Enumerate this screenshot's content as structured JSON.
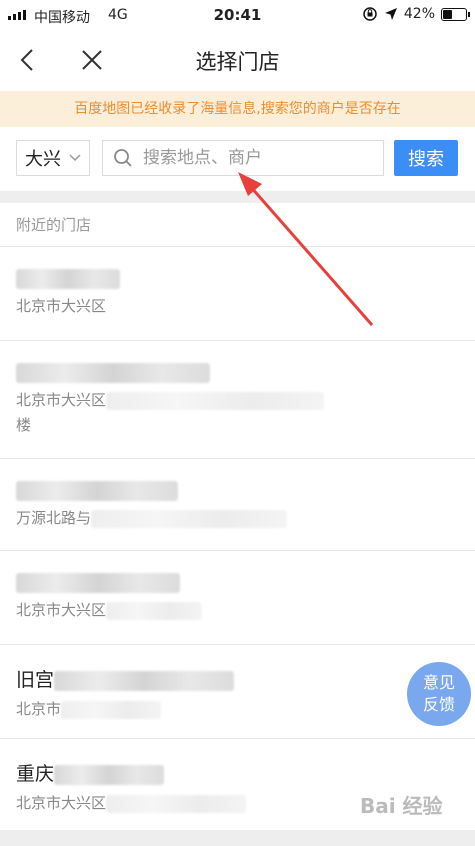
{
  "status_bar": {
    "carrier": "中国移动",
    "network": "4G",
    "time": "20:41",
    "battery": "42%",
    "battery_level": 0.42,
    "icons": [
      "signal-icon",
      "orientation-lock-icon",
      "location-arrow-icon",
      "battery-icon"
    ]
  },
  "nav": {
    "title": "选择门店",
    "back_icon": "chevron-left-icon",
    "close_icon": "close-icon"
  },
  "notice": {
    "text": "百度地图已经收录了海量信息,搜索您的商户是否存在"
  },
  "search": {
    "city": "大兴",
    "placeholder": "搜索地点、商户",
    "value": "",
    "button_label": "搜索"
  },
  "nearby": {
    "section_title": "附近的门店",
    "items": [
      {
        "name_prefix": "",
        "addr_prefix": "北京市大兴区",
        "addr_line2": ""
      },
      {
        "name_prefix": "",
        "addr_prefix": "北京市大兴区",
        "addr_line2": "楼"
      },
      {
        "name_prefix": "",
        "addr_prefix": "万源北路与",
        "addr_line2": ""
      },
      {
        "name_prefix": "",
        "addr_prefix": "北京市大兴区",
        "addr_line2": ""
      },
      {
        "name_prefix": "旧宫",
        "addr_prefix": "北京市",
        "addr_line2": ""
      },
      {
        "name_prefix": "重庆",
        "addr_prefix": "北京市大兴区",
        "addr_line2": ""
      }
    ]
  },
  "feedback": {
    "line1": "意见",
    "line2": "反馈"
  },
  "watermark": "Bai 经验",
  "colors": {
    "accent": "#3a8ef6",
    "notice_bg": "#fcefd9",
    "notice_text": "#ef8c2e",
    "annotation_arrow": "#e8413c",
    "feedback_bg": "#7aa8ef"
  }
}
